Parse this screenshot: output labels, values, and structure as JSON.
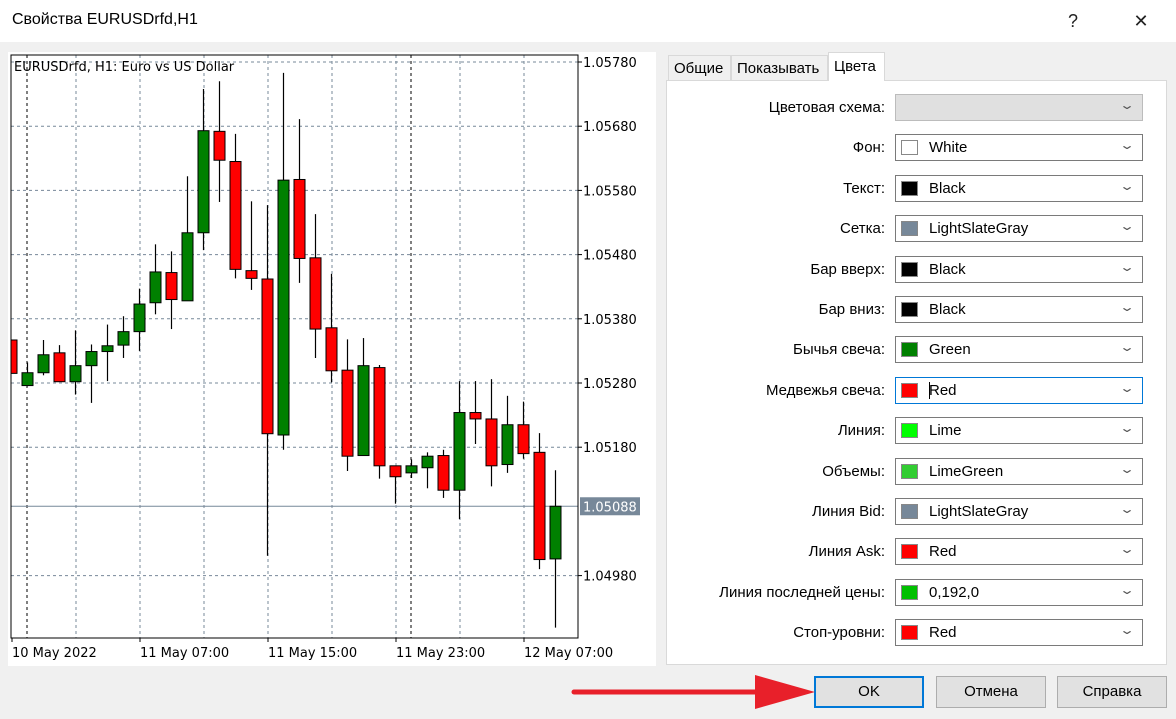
{
  "window": {
    "title": "Свойства EURUSDrfd,H1",
    "help_label": "?",
    "close_label": "✕"
  },
  "chart_data": {
    "type": "candlestick",
    "title": "EURUSDrfd, H1:  Euro vs US Dollar",
    "x_tick_labels": [
      "10 May 2022",
      "11 May 07:00",
      "11 May 15:00",
      "11 May 23:00",
      "12 May 07:00"
    ],
    "y_tick_labels": [
      "1.05780",
      "1.05680",
      "1.05580",
      "1.05480",
      "1.05380",
      "1.05280",
      "1.05180",
      "1.04980"
    ],
    "ylim": [
      1.0488,
      1.0579
    ],
    "grid": true,
    "bid_price": "1.05088",
    "colors": {
      "background": "#ffffff",
      "grid": "#778899",
      "bull": "#008000",
      "bear": "#ff0000",
      "outline": "#000000",
      "bid_line": "#778899"
    },
    "candles": [
      {
        "o": 1.05347,
        "h": 1.05347,
        "l": 1.05295,
        "c": 1.05295
      },
      {
        "o": 1.05276,
        "h": 1.05312,
        "l": 1.05275,
        "c": 1.05296
      },
      {
        "o": 1.05296,
        "h": 1.05347,
        "l": 1.05292,
        "c": 1.05324
      },
      {
        "o": 1.05327,
        "h": 1.05339,
        "l": 1.05282,
        "c": 1.05282
      },
      {
        "o": 1.05282,
        "h": 1.05362,
        "l": 1.05262,
        "c": 1.05307
      },
      {
        "o": 1.05307,
        "h": 1.0534,
        "l": 1.05249,
        "c": 1.05329
      },
      {
        "o": 1.05329,
        "h": 1.05371,
        "l": 1.05283,
        "c": 1.05338
      },
      {
        "o": 1.05339,
        "h": 1.05384,
        "l": 1.05319,
        "c": 1.0536
      },
      {
        "o": 1.0536,
        "h": 1.05427,
        "l": 1.0533,
        "c": 1.05403
      },
      {
        "o": 1.05405,
        "h": 1.05496,
        "l": 1.05387,
        "c": 1.05453
      },
      {
        "o": 1.05452,
        "h": 1.05485,
        "l": 1.05364,
        "c": 1.0541
      },
      {
        "o": 1.05408,
        "h": 1.05602,
        "l": 1.05408,
        "c": 1.05514
      },
      {
        "o": 1.05514,
        "h": 1.05738,
        "l": 1.05487,
        "c": 1.05673
      },
      {
        "o": 1.05672,
        "h": 1.0575,
        "l": 1.05562,
        "c": 1.05627
      },
      {
        "o": 1.05625,
        "h": 1.05668,
        "l": 1.05443,
        "c": 1.05457
      },
      {
        "o": 1.05455,
        "h": 1.05563,
        "l": 1.05425,
        "c": 1.05443
      },
      {
        "o": 1.05442,
        "h": 1.05557,
        "l": 1.05011,
        "c": 1.05201
      },
      {
        "o": 1.05199,
        "h": 1.05763,
        "l": 1.05176,
        "c": 1.05596
      },
      {
        "o": 1.05597,
        "h": 1.05691,
        "l": 1.05436,
        "c": 1.05474
      },
      {
        "o": 1.05475,
        "h": 1.05543,
        "l": 1.05319,
        "c": 1.05364
      },
      {
        "o": 1.05366,
        "h": 1.0545,
        "l": 1.05281,
        "c": 1.05299
      },
      {
        "o": 1.053,
        "h": 1.05348,
        "l": 1.05143,
        "c": 1.05166
      },
      {
        "o": 1.05167,
        "h": 1.0535,
        "l": 1.05167,
        "c": 1.05307
      },
      {
        "o": 1.05304,
        "h": 1.05308,
        "l": 1.05131,
        "c": 1.05151
      },
      {
        "o": 1.05151,
        "h": 1.05151,
        "l": 1.05092,
        "c": 1.05134
      },
      {
        "o": 1.0514,
        "h": 1.05161,
        "l": 1.05132,
        "c": 1.05151
      },
      {
        "o": 1.05148,
        "h": 1.05172,
        "l": 1.05116,
        "c": 1.05166
      },
      {
        "o": 1.05167,
        "h": 1.05176,
        "l": 1.05101,
        "c": 1.05113
      },
      {
        "o": 1.05113,
        "h": 1.05283,
        "l": 1.05068,
        "c": 1.05234
      },
      {
        "o": 1.05234,
        "h": 1.05283,
        "l": 1.05185,
        "c": 1.05224
      },
      {
        "o": 1.05224,
        "h": 1.05286,
        "l": 1.05119,
        "c": 1.05151
      },
      {
        "o": 1.05153,
        "h": 1.0526,
        "l": 1.0514,
        "c": 1.05215
      },
      {
        "o": 1.05215,
        "h": 1.05251,
        "l": 1.05162,
        "c": 1.0517
      },
      {
        "o": 1.05172,
        "h": 1.05202,
        "l": 1.0499,
        "c": 1.05005
      },
      {
        "o": 1.05006,
        "h": 1.05144,
        "l": 1.04899,
        "c": 1.05088
      }
    ]
  },
  "tabs": [
    {
      "label": "Общие",
      "active": false
    },
    {
      "label": "Показывать",
      "active": false
    },
    {
      "label": "Цвета",
      "active": true
    }
  ],
  "colors_tab": {
    "rows": [
      {
        "label": "Цветовая схема:",
        "value": "",
        "swatch": null,
        "disabled": true
      },
      {
        "label": "Фон:",
        "value": "White",
        "swatch": "#ffffff"
      },
      {
        "label": "Текст:",
        "value": "Black",
        "swatch": "#000000"
      },
      {
        "label": "Сетка:",
        "value": "LightSlateGray",
        "swatch": "#778899"
      },
      {
        "label": "Бар вверх:",
        "value": "Black",
        "swatch": "#000000"
      },
      {
        "label": "Бар вниз:",
        "value": "Black",
        "swatch": "#000000"
      },
      {
        "label": "Бычья свеча:",
        "value": "Green",
        "swatch": "#008000"
      },
      {
        "label": "Медвежья свеча:",
        "value": "Red",
        "swatch": "#ff0000",
        "focused": true
      },
      {
        "label": "Линия:",
        "value": "Lime",
        "swatch": "#00ff00"
      },
      {
        "label": "Объемы:",
        "value": "LimeGreen",
        "swatch": "#32cd32"
      },
      {
        "label": "Линия Bid:",
        "value": "LightSlateGray",
        "swatch": "#778899"
      },
      {
        "label": "Линия Ask:",
        "value": "Red",
        "swatch": "#ff0000"
      },
      {
        "label": "Линия последней цены:",
        "value": "0,192,0",
        "swatch": "#00c000"
      },
      {
        "label": "Стоп-уровни:",
        "value": "Red",
        "swatch": "#ff0000"
      }
    ]
  },
  "buttons": {
    "ok": "OK",
    "cancel": "Отмена",
    "help": "Справка"
  },
  "annotation": {
    "arrow_color": "#e8202a"
  }
}
